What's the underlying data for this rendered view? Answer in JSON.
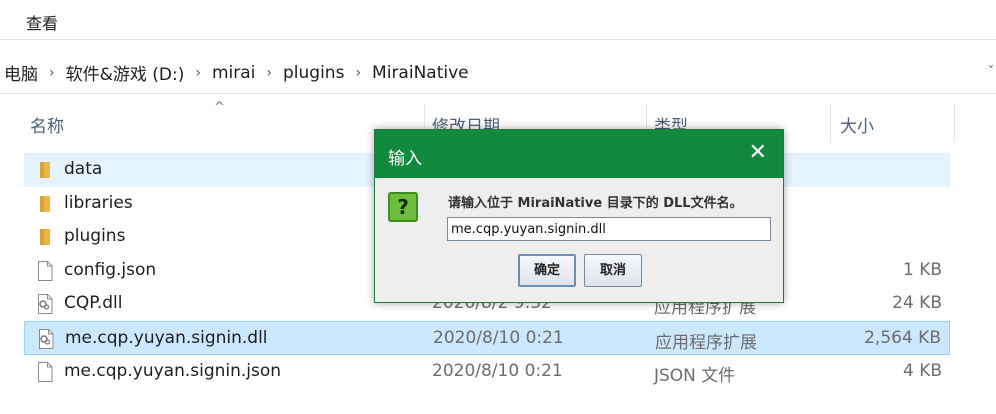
{
  "ribbon": {
    "tab_label": "查看"
  },
  "address": {
    "crumbs": [
      "电脑",
      "软件&游戏 (D:)",
      "mirai",
      "plugins",
      "MiraiNative"
    ],
    "separator": "›",
    "dropdown_glyph": "˅"
  },
  "columns": {
    "name": "名称",
    "date": "修改日期",
    "type": "类型",
    "size": "大小",
    "sort_indicator": "^"
  },
  "files": [
    {
      "name": "data",
      "date": "",
      "type": "",
      "size": "",
      "icon": "folder-icon"
    },
    {
      "name": "libraries",
      "date": "",
      "type": "",
      "size": "",
      "icon": "folder-icon"
    },
    {
      "name": "plugins",
      "date": "",
      "type": "",
      "size": "",
      "icon": "folder-icon"
    },
    {
      "name": "config.json",
      "date": "",
      "type": "",
      "size": "1 KB",
      "icon": "file-icon"
    },
    {
      "name": "CQP.dll",
      "date": "2020/8/2 9:32",
      "type": "应用程序扩展",
      "size": "24 KB",
      "icon": "dll-icon"
    },
    {
      "name": "me.cqp.yuyan.signin.dll",
      "date": "2020/8/10 0:21",
      "type": "应用程序扩展",
      "size": "2,564 KB",
      "icon": "dll-icon"
    },
    {
      "name": "me.cqp.yuyan.signin.json",
      "date": "2020/8/10 0:21",
      "type": "JSON 文件",
      "size": "4 KB",
      "icon": "file-icon"
    }
  ],
  "dialog": {
    "title": "输入",
    "close_glyph": "✕",
    "icon_glyph": "?",
    "message": "请输入位于 MiraiNative 目录下的 DLL文件名。",
    "input_value": "me.cqp.yuyan.signin.dll",
    "ok_label": "确定",
    "cancel_label": "取消"
  },
  "colors": {
    "title_bar": "#128a3d",
    "selection": "#cce8ff",
    "hover": "#e5f3ff"
  }
}
